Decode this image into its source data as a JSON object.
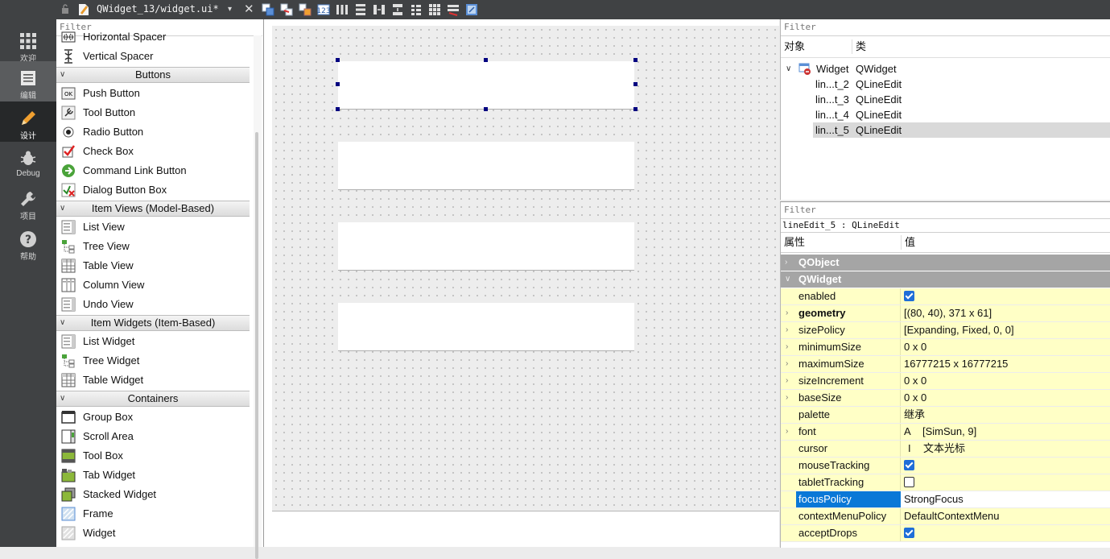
{
  "modes": [
    {
      "label": "欢迎",
      "icon": "grid-icon",
      "state": "normal"
    },
    {
      "label": "编辑",
      "icon": "edit-document-icon",
      "state": "highlight"
    },
    {
      "label": "设计",
      "icon": "pencil-icon",
      "state": "active"
    },
    {
      "label": "Debug",
      "icon": "bug-icon",
      "state": "normal"
    },
    {
      "label": "项目",
      "icon": "wrench-icon",
      "state": "normal"
    },
    {
      "label": "帮助",
      "icon": "help-icon",
      "state": "normal"
    }
  ],
  "toolbar": {
    "file_name": "QWidget_13/widget.ui*",
    "dropdown_glyph": "▾",
    "close_glyph": "✕",
    "tools": [
      "edit-widgets-icon",
      "edit-signals-icon",
      "edit-buddies-icon",
      "edit-tab-order-icon",
      "layout-horizontal-icon",
      "layout-vertical-icon",
      "layout-horizontal-splitter-icon",
      "layout-vertical-splitter-icon",
      "layout-form-icon",
      "layout-grid-icon",
      "break-layout-icon",
      "adjust-size-icon"
    ]
  },
  "widget_box": {
    "filter_placeholder": "Filter",
    "groups": [
      {
        "items": [
          {
            "label": "Horizontal Spacer",
            "icon": "horizontal-spacer-icon"
          },
          {
            "label": "Vertical Spacer",
            "icon": "vertical-spacer-icon"
          }
        ]
      },
      {
        "category": "Buttons",
        "items": [
          {
            "label": "Push Button",
            "icon": "push-button-icon"
          },
          {
            "label": "Tool Button",
            "icon": "tool-button-icon"
          },
          {
            "label": "Radio Button",
            "icon": "radio-button-icon"
          },
          {
            "label": "Check Box",
            "icon": "check-box-icon"
          },
          {
            "label": "Command Link Button",
            "icon": "command-link-icon"
          },
          {
            "label": "Dialog Button Box",
            "icon": "dialog-button-box-icon"
          }
        ]
      },
      {
        "category": "Item Views (Model-Based)",
        "items": [
          {
            "label": "List View",
            "icon": "list-view-icon"
          },
          {
            "label": "Tree View",
            "icon": "tree-view-icon"
          },
          {
            "label": "Table View",
            "icon": "table-view-icon"
          },
          {
            "label": "Column View",
            "icon": "column-view-icon"
          },
          {
            "label": "Undo View",
            "icon": "undo-view-icon"
          }
        ]
      },
      {
        "category": "Item Widgets (Item-Based)",
        "items": [
          {
            "label": "List Widget",
            "icon": "list-widget-icon"
          },
          {
            "label": "Tree Widget",
            "icon": "tree-widget-icon"
          },
          {
            "label": "Table Widget",
            "icon": "table-widget-icon"
          }
        ]
      },
      {
        "category": "Containers",
        "items": [
          {
            "label": "Group Box",
            "icon": "group-box-icon"
          },
          {
            "label": "Scroll Area",
            "icon": "scroll-area-icon"
          },
          {
            "label": "Tool Box",
            "icon": "tool-box-icon"
          },
          {
            "label": "Tab Widget",
            "icon": "tab-widget-icon"
          },
          {
            "label": "Stacked Widget",
            "icon": "stacked-widget-icon"
          },
          {
            "label": "Frame",
            "icon": "frame-icon"
          },
          {
            "label": "Widget",
            "icon": "widget-icon"
          }
        ]
      }
    ]
  },
  "object_inspector": {
    "filter_placeholder": "Filter",
    "col_object": "对象",
    "col_class": "类",
    "rows": [
      {
        "name": "Widget",
        "class": "QWidget",
        "level": 0,
        "selected": false
      },
      {
        "name": "lin...t_2",
        "class": "QLineEdit",
        "level": 1,
        "selected": false
      },
      {
        "name": "lin...t_3",
        "class": "QLineEdit",
        "level": 1,
        "selected": false
      },
      {
        "name": "lin...t_4",
        "class": "QLineEdit",
        "level": 1,
        "selected": false
      },
      {
        "name": "lin...t_5",
        "class": "QLineEdit",
        "level": 1,
        "selected": true
      }
    ]
  },
  "property_editor": {
    "filter_placeholder": "Filter",
    "class_line": "lineEdit_5 : QLineEdit",
    "col_property": "属性",
    "col_value": "值",
    "groups": [
      {
        "name": "QObject",
        "collapsed": true,
        "rows": []
      },
      {
        "name": "QWidget",
        "collapsed": false,
        "rows": [
          {
            "name": "enabled",
            "type": "check",
            "checked": true,
            "expandable": false
          },
          {
            "name": "geometry",
            "value": "[(80, 40), 371 x 61]",
            "expandable": true,
            "bold": true
          },
          {
            "name": "sizePolicy",
            "value": "[Expanding, Fixed, 0, 0]",
            "expandable": true
          },
          {
            "name": "minimumSize",
            "value": "0 x 0",
            "expandable": true
          },
          {
            "name": "maximumSize",
            "value": "16777215 x 16777215",
            "expandable": true
          },
          {
            "name": "sizeIncrement",
            "value": "0 x 0",
            "expandable": true
          },
          {
            "name": "baseSize",
            "value": "0 x 0",
            "expandable": true
          },
          {
            "name": "palette",
            "value": "继承",
            "expandable": false
          },
          {
            "name": "font",
            "value": "[SimSun, 9]",
            "icon_glyph": "A",
            "expandable": true
          },
          {
            "name": "cursor",
            "value": "文本光标",
            "icon_glyph": "I",
            "expandable": false
          },
          {
            "name": "mouseTracking",
            "type": "check",
            "checked": true,
            "expandable": false
          },
          {
            "name": "tabletTracking",
            "type": "check",
            "checked": false,
            "expandable": false
          },
          {
            "name": "focusPolicy",
            "value": "StrongFocus",
            "expandable": false,
            "selected": true
          },
          {
            "name": "contextMenuPolicy",
            "value": "DefaultContextMenu",
            "expandable": false
          },
          {
            "name": "acceptDrops",
            "type": "check",
            "checked": true,
            "expandable": false
          }
        ]
      }
    ]
  }
}
